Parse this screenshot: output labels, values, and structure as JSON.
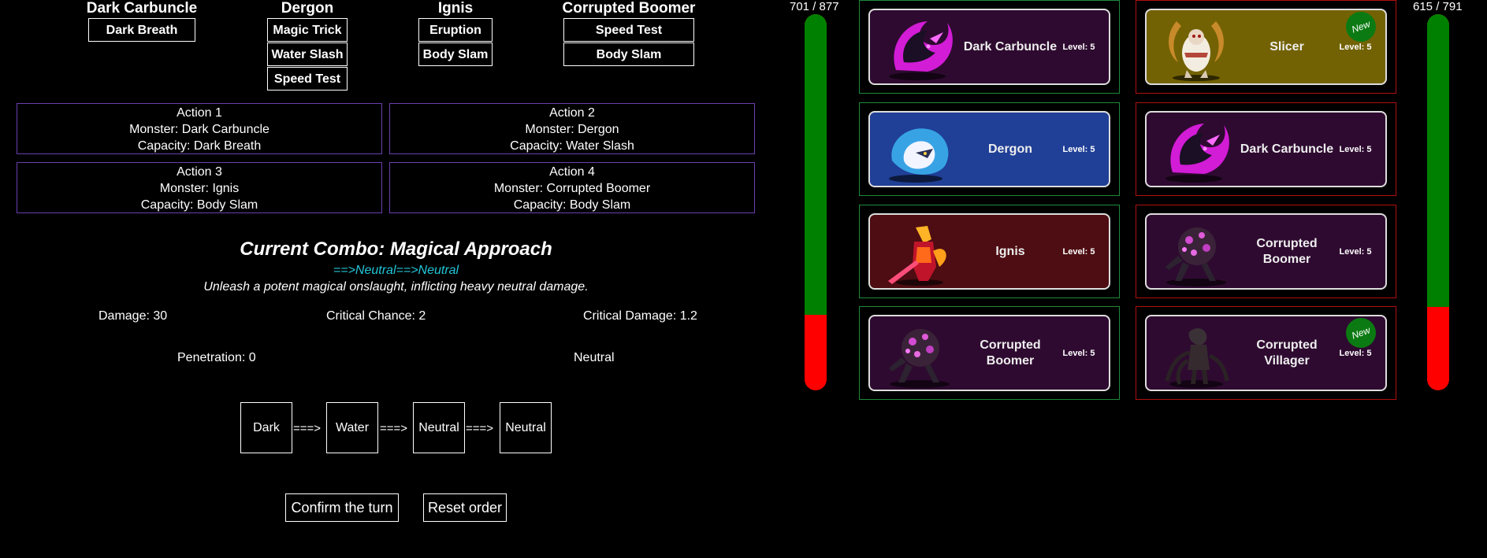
{
  "colors": {
    "background": "#000000",
    "accent_combo_path": "#22c6d8",
    "action_border": "#6a3fb0",
    "hp_green": "#008000",
    "hp_red": "#ff0000",
    "ally_border": "#1e8a3a",
    "enemy_border": "#b01010"
  },
  "monsters": [
    {
      "name": "Dark Carbuncle",
      "skills": [
        "Dark Breath"
      ]
    },
    {
      "name": "Dergon",
      "skills": [
        "Magic Trick",
        "Water Slash",
        "Speed Test"
      ]
    },
    {
      "name": "Ignis",
      "skills": [
        "Eruption",
        "Body Slam"
      ]
    },
    {
      "name": "Corrupted Boomer",
      "skills": [
        "Speed Test",
        "Body Slam"
      ]
    }
  ],
  "actions": [
    {
      "title": "Action 1",
      "monster": "Monster: Dark Carbuncle",
      "capacity": "Capacity: Dark Breath"
    },
    {
      "title": "Action 2",
      "monster": "Monster: Dergon",
      "capacity": "Capacity: Water Slash"
    },
    {
      "title": "Action 3",
      "monster": "Monster: Ignis",
      "capacity": "Capacity: Body Slam"
    },
    {
      "title": "Action 4",
      "monster": "Monster: Corrupted Boomer",
      "capacity": "Capacity: Body Slam"
    }
  ],
  "combo": {
    "title": "Current Combo: Magical Approach",
    "path": "==>Neutral==>Neutral",
    "description": "Unleash a potent magical onslaught, inflicting heavy neutral damage.",
    "damage": "Damage: 30",
    "crit_chance": "Critical Chance: 2",
    "crit_damage": "Critical Damage: 1.2",
    "penetration": "Penetration: 0",
    "element": "Neutral"
  },
  "chain": {
    "elements": [
      "Dark",
      "Water",
      "Neutral",
      "Neutral"
    ],
    "arrow": "===>"
  },
  "buttons": {
    "confirm": "Confirm the turn",
    "reset": "Reset order"
  },
  "player": {
    "hp_text": "701 / 877",
    "hp_ratio": 0.799,
    "cards": [
      {
        "name": "Dark Carbuncle",
        "level": "Level: 5",
        "color": "#2e0a30",
        "icon": "dark-carbuncle-portrait"
      },
      {
        "name": "Dergon",
        "level": "Level: 5",
        "color": "#203f96",
        "icon": "dergon-portrait"
      },
      {
        "name": "Ignis",
        "level": "Level: 5",
        "color": "#4d0d12",
        "icon": "ignis-portrait"
      },
      {
        "name": "Corrupted Boomer",
        "level": "Level: 5",
        "color": "#2e0a30",
        "icon": "corrupted-boomer-portrait"
      }
    ]
  },
  "enemy": {
    "hp_text": "615 / 791",
    "hp_ratio": 0.778,
    "cards": [
      {
        "name": "Slicer",
        "level": "Level: 5",
        "color": "#736203",
        "icon": "slicer-portrait",
        "badge": "New"
      },
      {
        "name": "Dark Carbuncle",
        "level": "Level: 5",
        "color": "#2e0a30",
        "icon": "dark-carbuncle-portrait"
      },
      {
        "name": "Corrupted Boomer",
        "level": "Level: 5",
        "color": "#2e0a30",
        "icon": "corrupted-boomer-portrait"
      },
      {
        "name": "Corrupted Villager",
        "level": "Level: 5",
        "color": "#2e0a30",
        "icon": "corrupted-villager-portrait",
        "badge": "New"
      }
    ]
  }
}
